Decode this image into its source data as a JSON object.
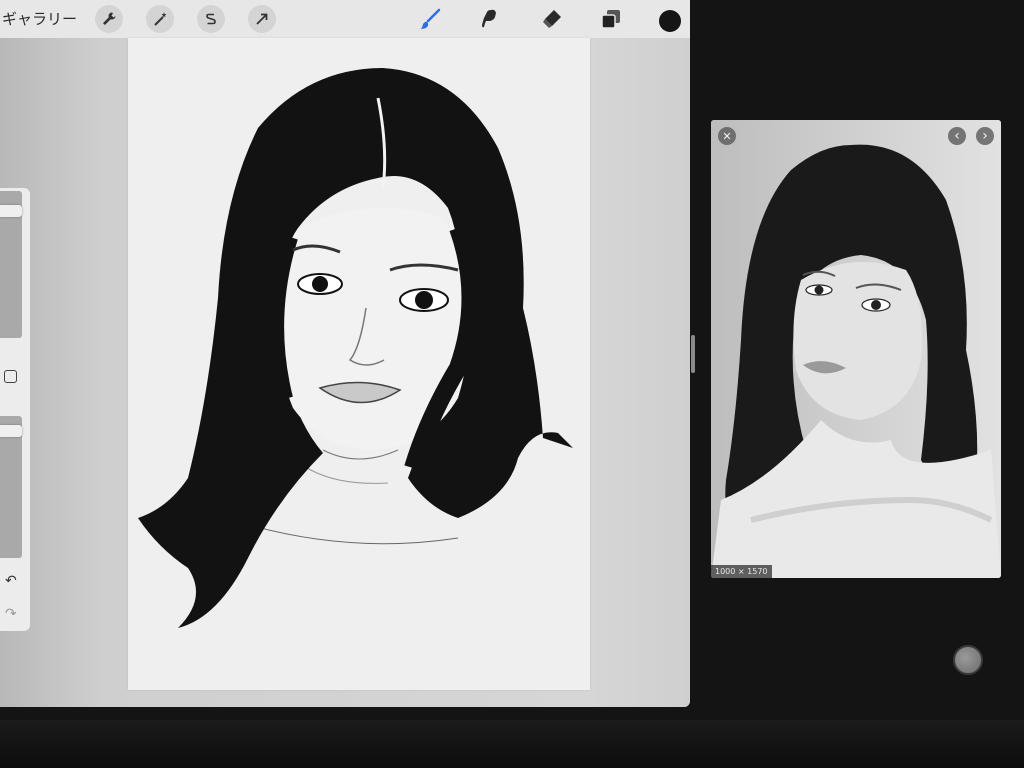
{
  "toolbar": {
    "gallery_label": "ギャラリー",
    "tools": {
      "actions": "wrench-icon",
      "adjustments": "magic-wand-icon",
      "selection": "selection-s-icon",
      "transform": "arrow-icon",
      "brush": "brush-icon",
      "smudge": "smudge-icon",
      "eraser": "eraser-icon",
      "layers": "layers-icon",
      "color": "color-swatch"
    },
    "active_tool": "brush",
    "accent_color": "#2f6fe4",
    "current_color": "#151515"
  },
  "sidebar": {
    "brush_size": 0.9,
    "opacity": 0.93,
    "undo_icon": "↶",
    "redo_icon": "↷"
  },
  "reference": {
    "close_icon": "✕",
    "prev_icon": "‹",
    "next_icon": "›",
    "image_size": "1000 × 1570"
  }
}
